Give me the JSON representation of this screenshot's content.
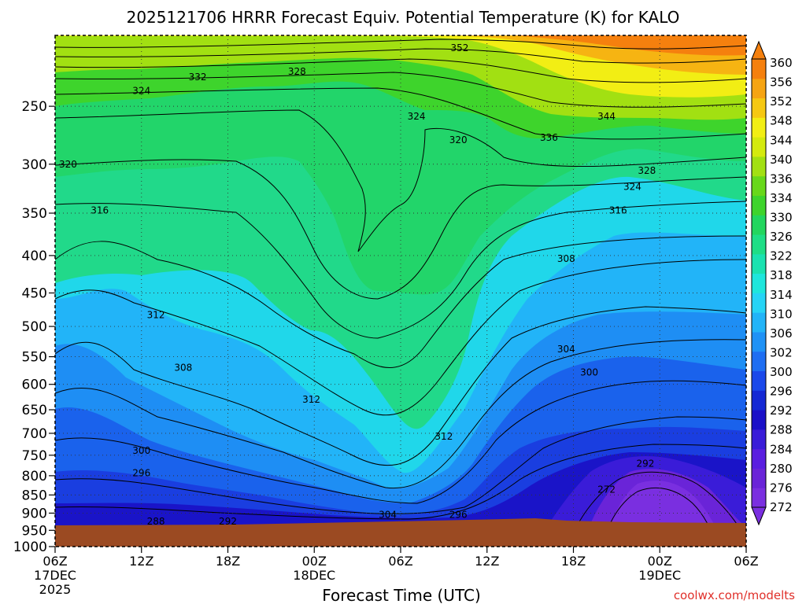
{
  "chart_data": {
    "type": "heatmap",
    "title": "2025121706 HRRR Forecast Equiv. Potential Temperature (K) for KALO",
    "xlabel": "Forecast Time (UTC)",
    "ylabel": "",
    "credit": "coolwx.com/modelts",
    "x_ticks": [
      {
        "hour": 0,
        "label": "06Z",
        "sub": "17DEC",
        "year": "2025"
      },
      {
        "hour": 6,
        "label": "12Z",
        "sub": "",
        "year": ""
      },
      {
        "hour": 12,
        "label": "18Z",
        "sub": "",
        "year": ""
      },
      {
        "hour": 18,
        "label": "00Z",
        "sub": "18DEC",
        "year": ""
      },
      {
        "hour": 24,
        "label": "06Z",
        "sub": "",
        "year": ""
      },
      {
        "hour": 30,
        "label": "12Z",
        "sub": "",
        "year": ""
      },
      {
        "hour": 36,
        "label": "18Z",
        "sub": "",
        "year": ""
      },
      {
        "hour": 42,
        "label": "00Z",
        "sub": "19DEC",
        "year": ""
      },
      {
        "hour": 48,
        "label": "06Z",
        "sub": "",
        "year": ""
      }
    ],
    "y_ticks": [
      250,
      300,
      350,
      400,
      450,
      500,
      550,
      600,
      650,
      700,
      750,
      800,
      850,
      900,
      950,
      1000
    ],
    "y_range_hpa": [
      200,
      1000
    ],
    "colorbar": {
      "levels": [
        272,
        276,
        280,
        284,
        288,
        292,
        296,
        300,
        302,
        306,
        310,
        314,
        318,
        322,
        326,
        330,
        334,
        336,
        340,
        344,
        348,
        352,
        356,
        360
      ],
      "colors": [
        "#7a2fe0",
        "#6a24d8",
        "#5a1ee0",
        "#3a1cd8",
        "#1a10c8",
        "#1428d4",
        "#1a48ea",
        "#1e6ef2",
        "#1f92f6",
        "#22b4f8",
        "#26d4f6",
        "#1ee6dc",
        "#1ae2b0",
        "#1ede86",
        "#22d65e",
        "#3ed42c",
        "#68d81a",
        "#a2e012",
        "#d4ea0e",
        "#f2ee14",
        "#f6c812",
        "#f6a412",
        "#f5800e"
      ]
    },
    "contour_labels": [
      {
        "v": "352",
        "hour": 28.1,
        "hpa": 208
      },
      {
        "v": "332",
        "hour": 9.9,
        "hpa": 228
      },
      {
        "v": "328",
        "hour": 16.8,
        "hpa": 224
      },
      {
        "v": "324",
        "hour": 6.0,
        "hpa": 238
      },
      {
        "v": "324",
        "hour": 25.1,
        "hpa": 258
      },
      {
        "v": "344",
        "hour": 38.3,
        "hpa": 258
      },
      {
        "v": "336",
        "hour": 34.3,
        "hpa": 276
      },
      {
        "v": "320",
        "hour": 28.0,
        "hpa": 278
      },
      {
        "v": "320",
        "hour": 0.9,
        "hpa": 300
      },
      {
        "v": "328",
        "hour": 41.1,
        "hpa": 306
      },
      {
        "v": "324",
        "hour": 40.1,
        "hpa": 322
      },
      {
        "v": "316",
        "hour": 3.1,
        "hpa": 347
      },
      {
        "v": "316",
        "hour": 39.1,
        "hpa": 347
      },
      {
        "v": "308",
        "hour": 35.5,
        "hpa": 404
      },
      {
        "v": "312",
        "hour": 7.0,
        "hpa": 482
      },
      {
        "v": "304",
        "hour": 35.5,
        "hpa": 537
      },
      {
        "v": "308",
        "hour": 8.9,
        "hpa": 569
      },
      {
        "v": "300",
        "hour": 37.1,
        "hpa": 578
      },
      {
        "v": "312",
        "hour": 17.8,
        "hpa": 629
      },
      {
        "v": "312",
        "hour": 27.0,
        "hpa": 707
      },
      {
        "v": "300",
        "hour": 6.0,
        "hpa": 739
      },
      {
        "v": "292",
        "hour": 41.0,
        "hpa": 770
      },
      {
        "v": "296",
        "hour": 6.0,
        "hpa": 793
      },
      {
        "v": "272",
        "hour": 38.3,
        "hpa": 836
      },
      {
        "v": "304",
        "hour": 23.1,
        "hpa": 905
      },
      {
        "v": "296",
        "hour": 28.0,
        "hpa": 905
      },
      {
        "v": "288",
        "hour": 7.0,
        "hpa": 924
      },
      {
        "v": "292",
        "hour": 12.0,
        "hpa": 924
      }
    ],
    "grid": true,
    "legend": "right colorbar"
  }
}
